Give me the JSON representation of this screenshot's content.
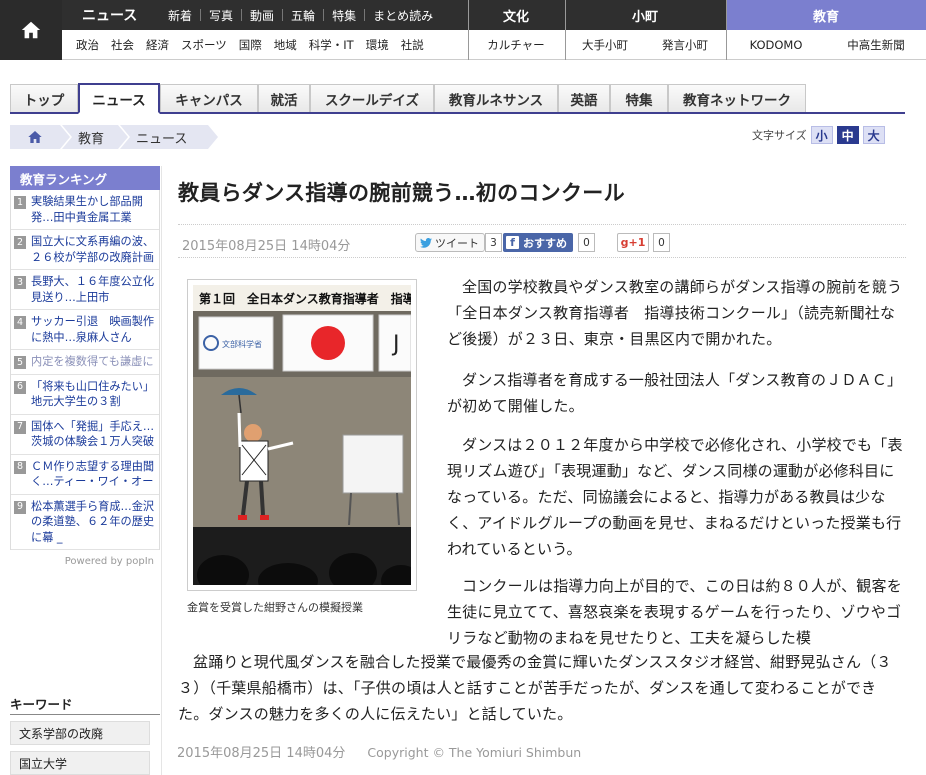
{
  "global_nav": {
    "news_label": "ニュース",
    "news_sub": [
      "新着",
      "写真",
      "動画",
      "五輪",
      "特集",
      "まとめ読み"
    ],
    "news_cats": [
      "政治",
      "社会",
      "経済",
      "スポーツ",
      "国際",
      "地域",
      "科学・IT",
      "環境",
      "社説"
    ],
    "culture_label": "文化",
    "culture_sub": "カルチャー",
    "komachi_label": "小町",
    "komachi_sub": [
      "大手小町",
      "発言小町"
    ],
    "edu_label": "教育",
    "edu_sub": [
      "KODOMO",
      "中高生新聞"
    ]
  },
  "tabs": [
    "トップ",
    "ニュース",
    "キャンパス",
    "就活",
    "スクールデイズ",
    "教育ルネサンス",
    "英語",
    "特集",
    "教育ネットワーク"
  ],
  "breadcrumb": [
    "教育",
    "ニュース"
  ],
  "font_size": {
    "label": "文字サイズ",
    "small": "小",
    "medium": "中",
    "large": "大"
  },
  "sidebar": {
    "ranking_title": "教育ランキング",
    "ranking": [
      {
        "num": "1",
        "text": "実験結果生かし部品開発…田中貴金属工業"
      },
      {
        "num": "2",
        "text": "国立大に文系再編の波、２６校が学部の改廃計画"
      },
      {
        "num": "3",
        "text": "長野大、１６年度公立化見送り…上田市"
      },
      {
        "num": "4",
        "text": "サッカー引退　映画製作に熱中…泉麻人さん"
      },
      {
        "num": "5",
        "text": "内定を複数得ても謙虚に"
      },
      {
        "num": "6",
        "text": "「将来も山口住みたい」地元大学生の３割"
      },
      {
        "num": "7",
        "text": "国体へ「発掘」手応え…茨城の体験会１万人突破"
      },
      {
        "num": "8",
        "text": "ＣＭ作り志望する理由聞く…ティー・ワイ・オー"
      },
      {
        "num": "9",
        "text": "松本薫選手ら育成…金沢の柔道塾、６２年の歴史に幕 _"
      }
    ],
    "powered": "Powered by popIn",
    "keyword_title": "キーワード",
    "keywords": [
      "文系学部の改廃",
      "国立大学"
    ]
  },
  "article": {
    "title": "教員らダンス指導の腕前競う…初のコンクール",
    "date": "2015年08月25日 14時04分",
    "tweet_label": "ツイート",
    "tweet_count": "3",
    "fb_label": "おすすめ",
    "fb_count": "0",
    "gplus_label": "g+1",
    "gplus_count": "0",
    "photo_caption": "金賞を受賞した紺野さんの模擬授業",
    "photo_banner": "第１回　全日本ダンス教育指導者　指導",
    "photo_sign": "文部科学省",
    "photo_letter": "J",
    "paragraphs": [
      "全国の学校教員やダンス教室の講師らがダンス指導の腕前を競う「全日本ダンス教育指導者　指導技術コンクール」（読売新聞社など後援）が２３日、東京・目黒区内で開かれた。",
      "ダンス指導者を育成する一般社団法人「ダンス教育のＪＤＡＣ」が初めて開催した。",
      "ダンスは２０１２年度から中学校で必修化され、小学校でも「表現リズム遊び」「表現運動」など、ダンス同様の運動が必修科目になっている。ただ、同協議会によると、指導力がある教員は少なく、アイドルグループの動画を見せ、まねるだけといった授業も行われているという。",
      "コンクールは指導力向上が目的で、この日は約８０人が、観客を生徒に見立てて、喜怒哀楽を表現するゲームを行ったり、ゾウやゴリラなど動物のまねを見せたりと、工夫を凝らした模",
      "盆踊りと現代風ダンスを融合した授業で最優秀の金賞に輝いたダンススタジオ経営、紺野晃弘さん（３３）（千葉県船橋市）は、「子供の頃は人と話すことが苦手だったが、ダンスを通して変わることができた。ダンスの魅力を多くの人に伝えたい」と話していた。"
    ],
    "footer_date": "2015年08月25日 14時04分",
    "copyright": "Copyright © The Yomiuri Shimbun"
  },
  "colors": {
    "accent": "#7b7fcf",
    "nav_dark": "#2f2f2f",
    "link": "#1a3a9a",
    "tab_border": "#3f3f8f",
    "facebook": "#4a66a8"
  }
}
